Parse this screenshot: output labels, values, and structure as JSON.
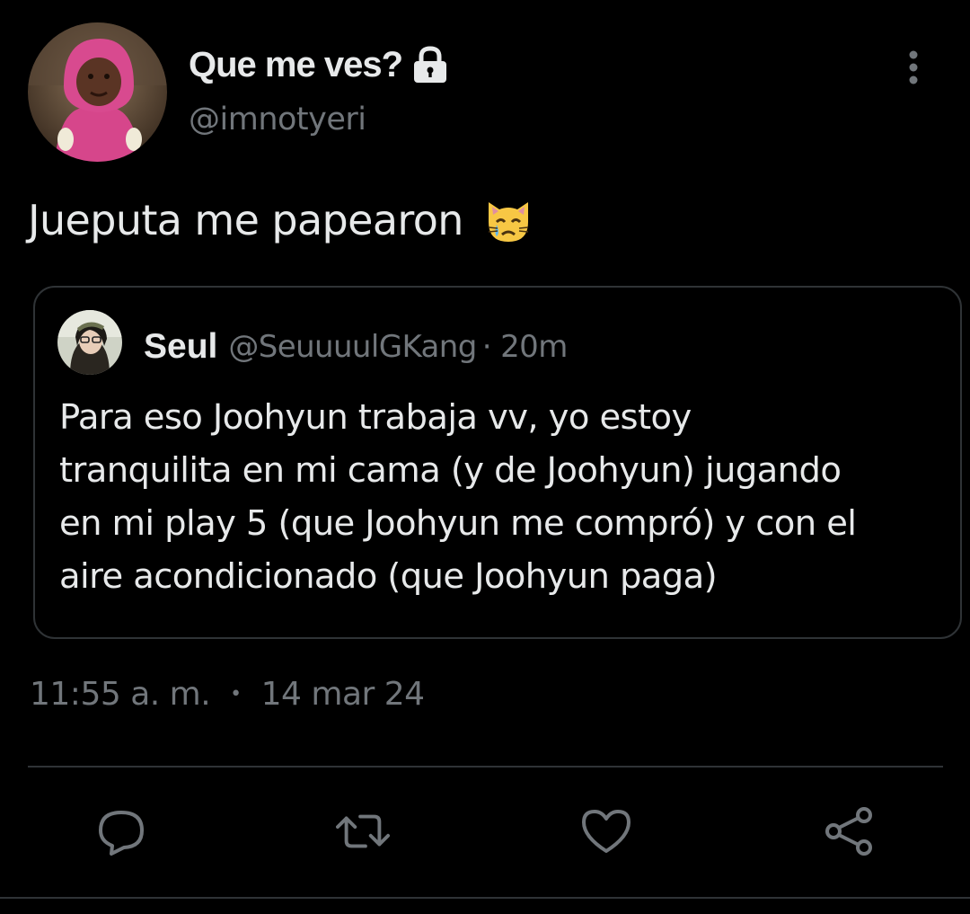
{
  "tweet": {
    "author_name": "Que me ves?",
    "author_handle": "@imnotyeri",
    "text": "Jueputa me papearon",
    "emoji": "crying-cat-face-emoji",
    "time": "11:55 a. m.",
    "separator": "•",
    "date": "14 mar 24"
  },
  "quoted": {
    "author_name": "Seul",
    "author_handle": "@SeuuuulGKang",
    "age": "· 20m",
    "lines": [
      "Para eso Joohyun trabaja vv, yo estoy",
      "tranquilita en mi cama (y de Joohyun) jugando",
      "en mi play 5 (que Joohyun me compró) y con el",
      "aire acondicionado (que Joohyun paga)"
    ]
  },
  "actions": {
    "icons": [
      "reply-icon",
      "retweet-icon",
      "like-icon",
      "share-icon"
    ]
  },
  "colors": {
    "background": "#000000",
    "primary_text": "#e7e9ea",
    "secondary_text": "#71767b",
    "border": "#2f3336"
  }
}
